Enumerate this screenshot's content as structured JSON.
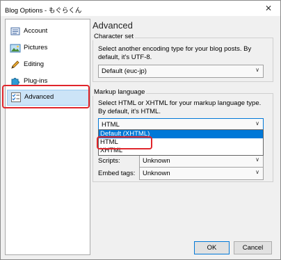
{
  "window": {
    "title": "Blog Options - もぐらくん",
    "close_glyph": "✕"
  },
  "sidebar": {
    "items": [
      {
        "label": "Account",
        "icon": "account-card-icon"
      },
      {
        "label": "Pictures",
        "icon": "picture-icon"
      },
      {
        "label": "Editing",
        "icon": "pencil-icon"
      },
      {
        "label": "Plug-ins",
        "icon": "puzzle-icon"
      },
      {
        "label": "Advanced",
        "icon": "checklist-icon",
        "selected": true
      }
    ]
  },
  "main": {
    "heading": "Advanced",
    "charset": {
      "group_label": "Character set",
      "description": "Select another encoding type for your blog posts. By default, it's UTF-8.",
      "selected": "Default (euc-jp)"
    },
    "markup": {
      "group_label": "Markup language",
      "description": "Select HTML or XHTML for your markup language type. By default, it's HTML.",
      "selected": "HTML",
      "options": [
        "Default (XHTML)",
        "HTML",
        "XHTML"
      ],
      "highlighted_option": "Default (XHTML)"
    },
    "rows": [
      {
        "label": "Scripts:",
        "value": "Unknown"
      },
      {
        "label": "Embed tags:",
        "value": "Unknown"
      }
    ]
  },
  "footer": {
    "ok_label": "OK",
    "cancel_label": "Cancel"
  },
  "colors": {
    "highlight": "#0078d7",
    "annotation_red": "#e0252b",
    "selection_bg": "#cce4f7"
  }
}
